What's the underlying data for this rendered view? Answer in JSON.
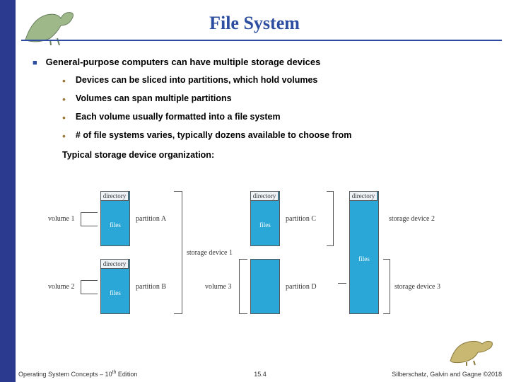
{
  "title": "File System",
  "main_bullet": "General-purpose computers can have multiple storage devices",
  "sub_bullets": [
    "Devices can be sliced into partitions, which hold volumes",
    "Volumes can span multiple partitions",
    "Each volume usually formatted into a file system",
    "# of file systems varies, typically dozens available to choose from"
  ],
  "typical_label": "Typical storage device organization:",
  "diagram": {
    "directory": "directory",
    "files": "files",
    "volume1": "volume 1",
    "volume2": "volume 2",
    "volume3": "volume 3",
    "partitionA": "partition A",
    "partitionB": "partition B",
    "partitionC": "partition C",
    "partitionD": "partition D",
    "storage1": "storage device 1",
    "storage2": "storage device 2",
    "storage3": "storage device 3"
  },
  "footer": {
    "left_a": "Operating System Concepts – 10",
    "left_sup": "th",
    "left_b": " Edition",
    "center": "15.4",
    "right": "Silberschatz, Galvin and Gagne ©2018"
  }
}
